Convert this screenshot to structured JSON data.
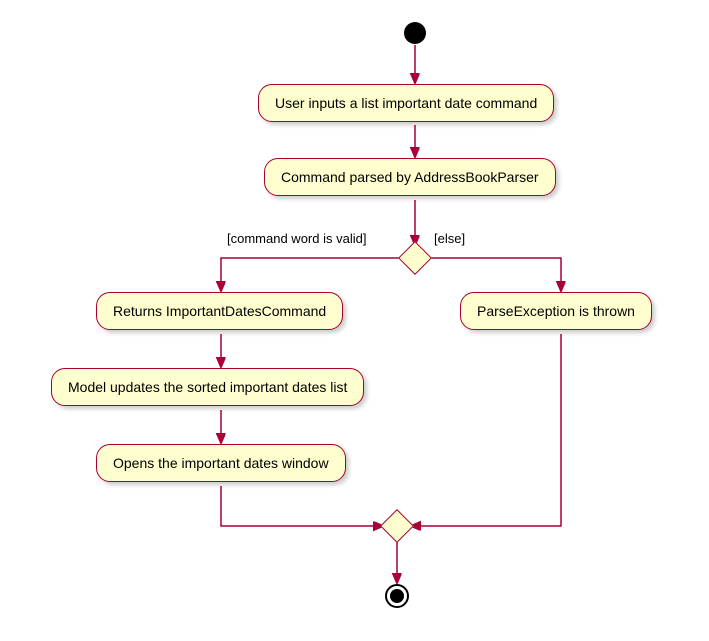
{
  "chart_data": {
    "type": "activity-diagram",
    "start": true,
    "nodes": [
      {
        "id": "n1",
        "label": "User inputs a list important date command"
      },
      {
        "id": "n2",
        "label": "Command parsed by AddressBookParser"
      }
    ],
    "decision": {
      "guard_left": "[command word is valid]",
      "guard_right": "[else]",
      "left_branch": [
        {
          "id": "n3",
          "label": "Returns ImportantDatesCommand"
        },
        {
          "id": "n4",
          "label": "Model updates the sorted important dates list"
        },
        {
          "id": "n5",
          "label": "Opens the important dates window"
        }
      ],
      "right_branch": [
        {
          "id": "n6",
          "label": "ParseException is thrown"
        }
      ]
    },
    "merge": true,
    "end": true
  }
}
